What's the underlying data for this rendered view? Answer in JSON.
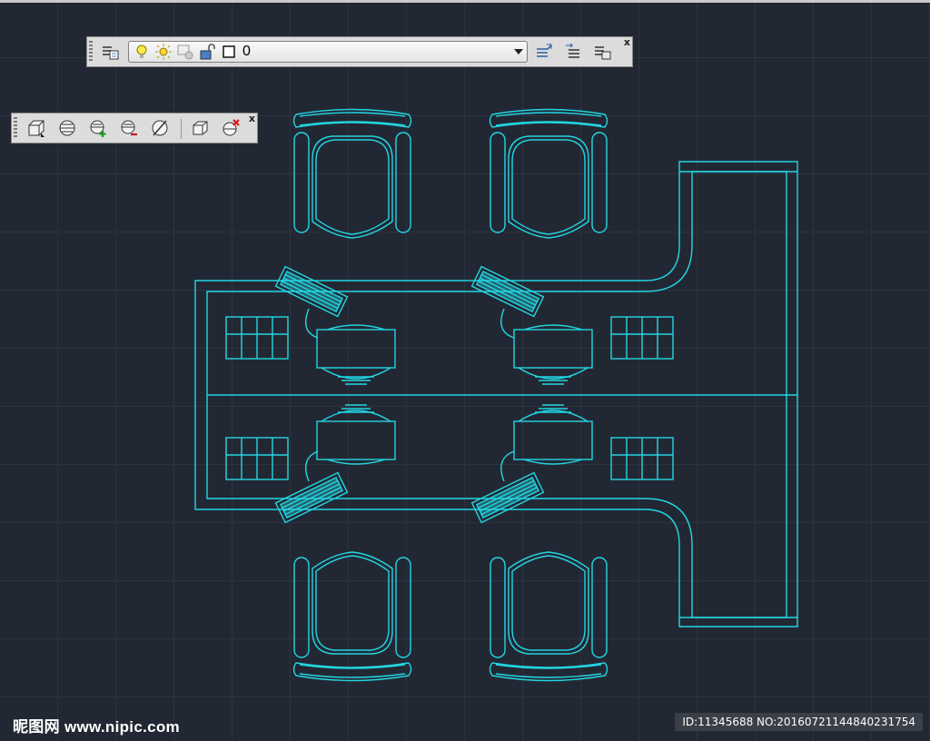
{
  "layer_toolbar": {
    "current_layer": "0",
    "icons": [
      "layer-properties-icon",
      "layer-on-bulb-icon",
      "layer-thaw-sun-icon",
      "layer-viewport-freeze-icon",
      "layer-unlock-icon",
      "layer-color-square-icon",
      "make-current-layer-icon",
      "layer-previous-icon",
      "layer-states-icon"
    ],
    "close_label": "x"
  },
  "solid_editing_toolbar": {
    "icons": [
      "box-3d-icon",
      "sphere-wire-icon",
      "sphere-add-icon",
      "sphere-subtract-icon",
      "slice-icon",
      "solid-cube-icon",
      "solid-delete-icon"
    ],
    "close_label": "x"
  },
  "colors": {
    "background": "#222833",
    "grid": "#2c3340",
    "drawing_line": "#22d6e3"
  },
  "watermark": {
    "site_cn": "昵图网",
    "site_url": "www.nipic.com",
    "id_text": "ID:11345688 NO:20160721144840231754"
  }
}
